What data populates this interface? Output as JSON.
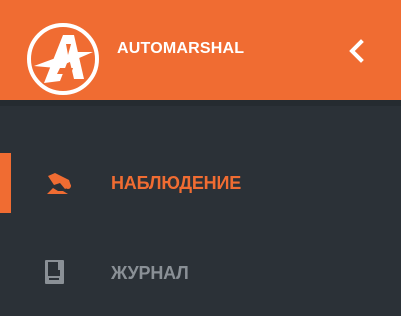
{
  "app": {
    "brand_name": "AUTOMARSHAL",
    "accent_color": "#f06c32",
    "sidebar_color": "#2b3137"
  },
  "header": {
    "collapse_icon": "chevron-left-icon"
  },
  "menu": {
    "items": [
      {
        "label": "НАБЛЮДЕНИЕ",
        "icon": "surveillance-camera-icon",
        "active": true
      },
      {
        "label": "ЖУРНАЛ",
        "icon": "journal-icon",
        "active": false
      }
    ]
  }
}
